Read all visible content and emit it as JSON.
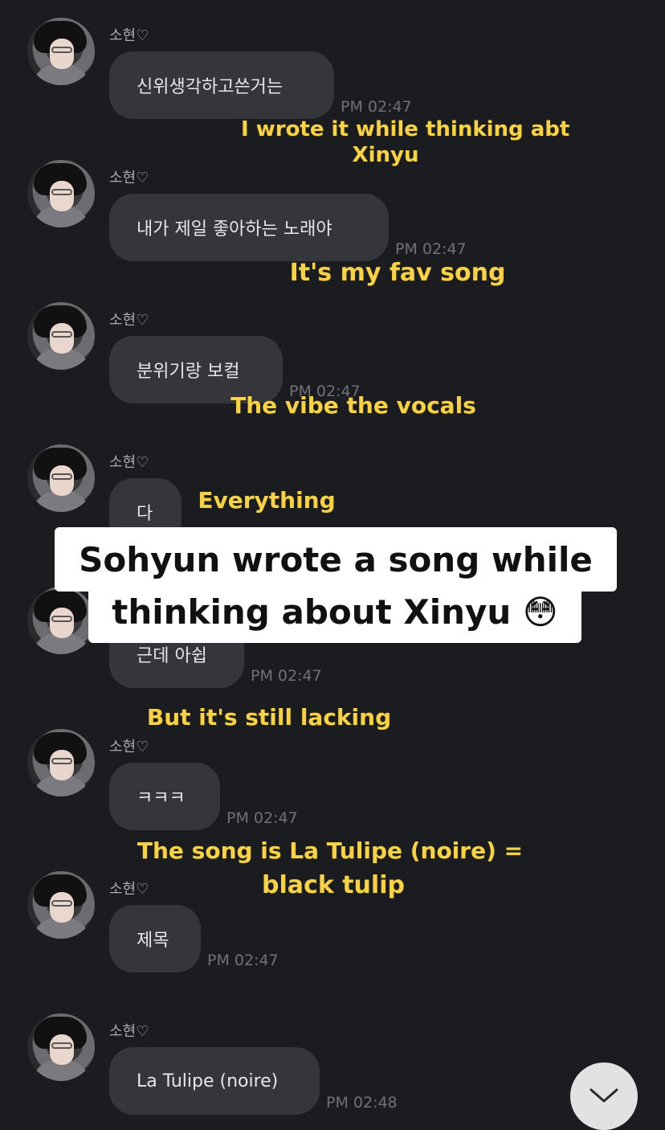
{
  "messages": [
    {
      "sender": "소현♡",
      "text": "신위생각하고쓴거는",
      "time": "PM 02:47"
    },
    {
      "sender": "소현♡",
      "text": "내가 제일 좋아하는 노래야",
      "time": "PM 02:47"
    },
    {
      "sender": "소현♡",
      "text": "분위기랑 보컬",
      "time": "PM 02:47"
    },
    {
      "sender": "소현♡",
      "text": "다",
      "time": ""
    },
    {
      "sender": "",
      "text": "근데 아쉽",
      "time": "PM 02:47"
    },
    {
      "sender": "소현♡",
      "text": "ㅋㅋㅋ",
      "time": "PM 02:47"
    },
    {
      "sender": "소현♡",
      "text": "제목",
      "time": "PM 02:47"
    },
    {
      "sender": "소현♡",
      "text": "La Tulipe (noire)",
      "time": "PM 02:48"
    }
  ],
  "captions": [
    "I wrote it while thinking abt",
    "Xinyu",
    "It's my fav song",
    "The vibe the vocals",
    "Everything",
    "But it's still lacking",
    "The song is La Tulipe (noire) =",
    "black tulip"
  ],
  "overlay": {
    "line1": "Sohyun wrote a song while",
    "line2": "thinking about Xinyu 😳"
  },
  "icons": {
    "scroll_down": "chevron-down-icon"
  },
  "colors": {
    "background": "#1b1c20",
    "bubble": "#34363c",
    "caption": "#f6d14b"
  }
}
